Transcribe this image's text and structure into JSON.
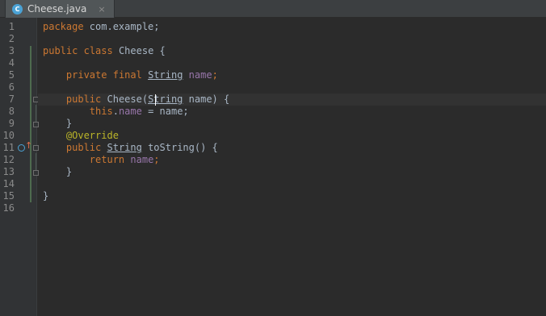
{
  "tab": {
    "icon_letter": "C",
    "title": "Cheese.java",
    "close": "×"
  },
  "gutter": {
    "line_numbers": [
      "1",
      "2",
      "3",
      "4",
      "5",
      "6",
      "7",
      "8",
      "9",
      "10",
      "11",
      "12",
      "13",
      "14",
      "15",
      "16"
    ]
  },
  "code": {
    "l1": {
      "kw": "package",
      "rest": " com.example;"
    },
    "l3": {
      "kw1": "public",
      "kw2": "class",
      "rest": " Cheese {"
    },
    "l5": {
      "kw1": "private",
      "kw2": "final",
      "type": "String",
      "field": "name",
      "semi": ";"
    },
    "l7": {
      "kw": "public",
      "name": " Cheese(",
      "type": "String",
      "rest": " name) {"
    },
    "l8": {
      "kw": "this",
      "dot": ".",
      "field": "name",
      "rest": " = name;"
    },
    "l9": {
      "rest": "}"
    },
    "l10": {
      "ann": "@Override"
    },
    "l11": {
      "kw": "public",
      "type": "String",
      "rest": " toString() {"
    },
    "l12": {
      "kw": "return",
      "field": "name",
      "semi": ";"
    },
    "l13": {
      "rest": "}"
    },
    "l15": {
      "rest": "}"
    }
  },
  "colors": {
    "background": "#2b2b2b",
    "keyword": "#cc7832",
    "field": "#9876aa",
    "annotation": "#bbb529",
    "text": "#a9b7c6",
    "gutter": "#313335"
  }
}
